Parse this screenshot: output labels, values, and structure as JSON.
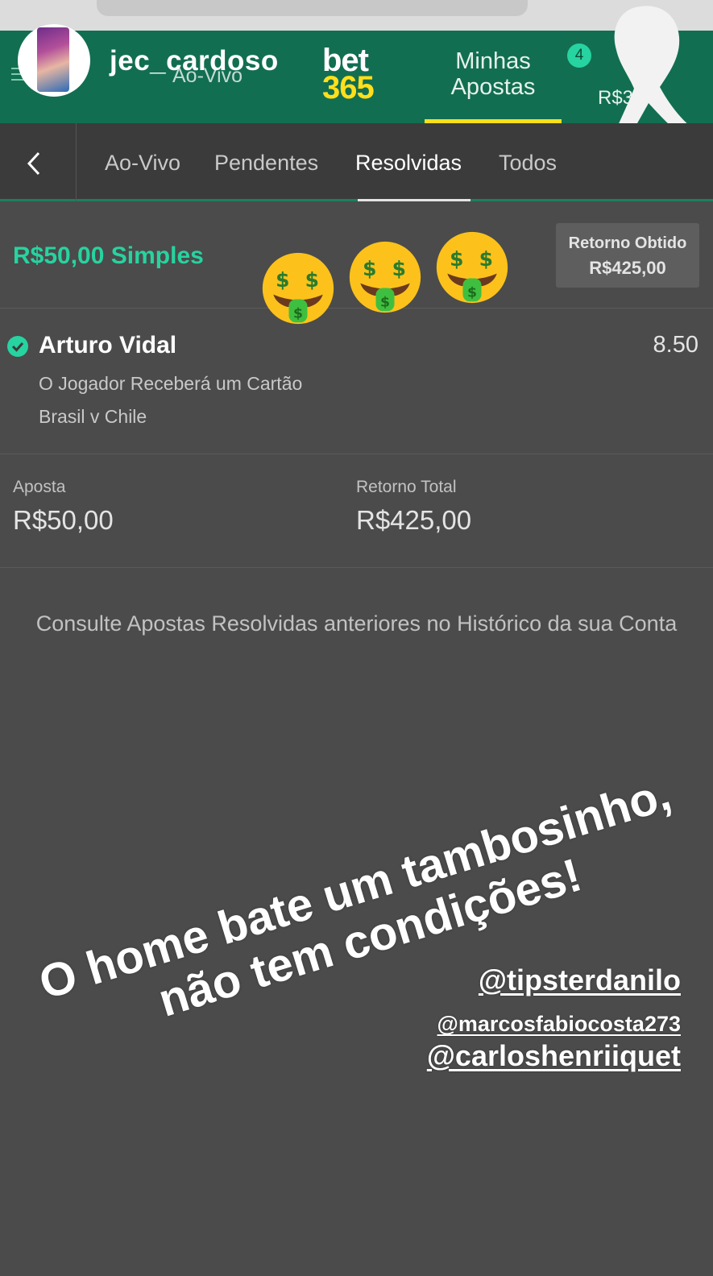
{
  "story": {
    "username": "jec_cardoso"
  },
  "header": {
    "ghost_tab": "Ao-Vivo",
    "logo_line1": "bet",
    "logo_line2": "365",
    "my_bets_line1": "Minhas",
    "my_bets_line2": "Apostas",
    "badge_count": "4",
    "balance": "R$3"
  },
  "subnav": {
    "tabs": [
      {
        "label": "Ao-Vivo"
      },
      {
        "label": "Pendentes"
      },
      {
        "label": "Resolvidas"
      },
      {
        "label": "Todos"
      }
    ],
    "active_tab": "Resolvidas"
  },
  "bet": {
    "stake_title": "R$50,00 Simples",
    "return_label": "Retorno Obtido",
    "return_value": "R$425,00",
    "selection": {
      "name": "Arturo Vidal",
      "odds": "8.50",
      "market": "O Jogador Receberá um Cartão",
      "event": "Brasil v Chile"
    },
    "stake_label": "Aposta",
    "stake_value": "R$50,00",
    "total_return_label": "Retorno Total",
    "total_return_value": "R$425,00"
  },
  "history_note": "Consulte Apostas Resolvidas anteriores no Histórico da sua Conta",
  "caption": {
    "line1": "O home bate um tambosinho,",
    "line2": "não tem condições!"
  },
  "mentions": [
    "@tipsterdanilo",
    "@marcosfabiocosta273",
    "@carloshenriiquet"
  ],
  "icons": {
    "emoji": "money-mouth-face",
    "check": "check-circle",
    "back": "chevron-left"
  },
  "colors": {
    "brand_green": "#126e51",
    "accent_green": "#27d3a0",
    "logo_yellow": "#ffdf1b",
    "background": "#4b4b4b"
  }
}
